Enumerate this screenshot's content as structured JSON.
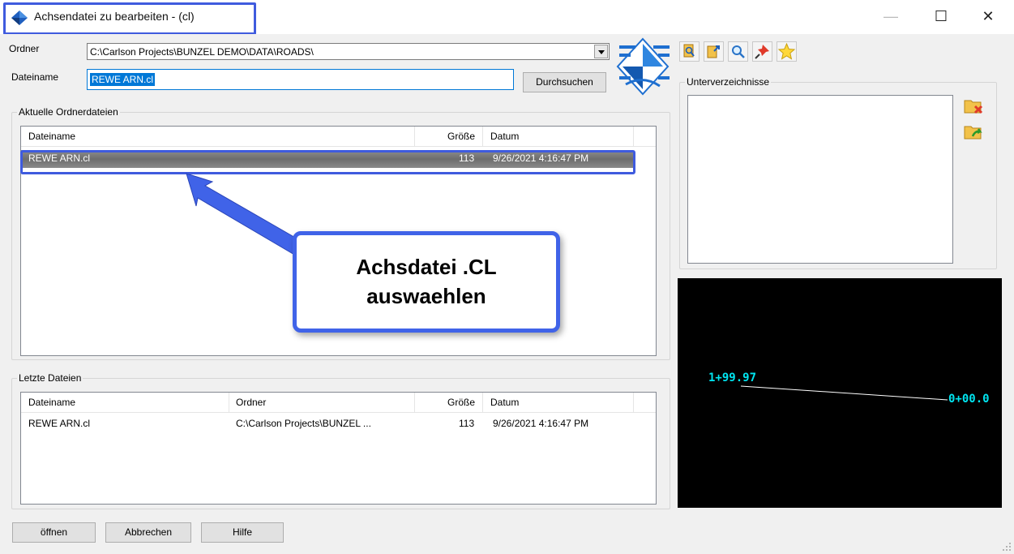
{
  "window": {
    "title": "Achsendatei zu bearbeiten - (cl)",
    "minimize": "—",
    "maximize": "☐",
    "close": "✕"
  },
  "folder": {
    "label": "Ordner",
    "value": "C:\\Carlson Projects\\BUNZEL DEMO\\DATA\\ROADS\\"
  },
  "filename": {
    "label": "Dateiname",
    "value": "REWE ARN.cl",
    "browse_label": "Durchsuchen"
  },
  "subdirs": {
    "title": "Unterverzeichnisse"
  },
  "current_files": {
    "title": "Aktuelle Ordnerdateien",
    "columns": [
      "Dateiname",
      "Größe",
      "Datum"
    ],
    "rows": [
      {
        "name": "REWE ARN.cl",
        "size": "113",
        "date": "9/26/2021 4:16:47 PM"
      }
    ]
  },
  "recent_files": {
    "title": "Letzte Dateien",
    "columns": [
      "Dateiname",
      "Ordner",
      "Größe",
      "Datum"
    ],
    "rows": [
      {
        "name": "REWE ARN.cl",
        "folder": "C:\\Carlson Projects\\BUNZEL ...",
        "size": "113",
        "date": "9/26/2021 4:16:47 PM"
      }
    ]
  },
  "callout": {
    "line1": "Achsdatei .CL",
    "line2": "auswaehlen"
  },
  "preview": {
    "station_start": "1+99.97",
    "station_end": "0+00.0"
  },
  "buttons": {
    "open": "öffnen",
    "cancel": "Abbrechen",
    "help": "Hilfe"
  },
  "colors": {
    "accent": "#3f5bde",
    "selection": "#0078d7",
    "preview_text": "#00e5f0"
  }
}
